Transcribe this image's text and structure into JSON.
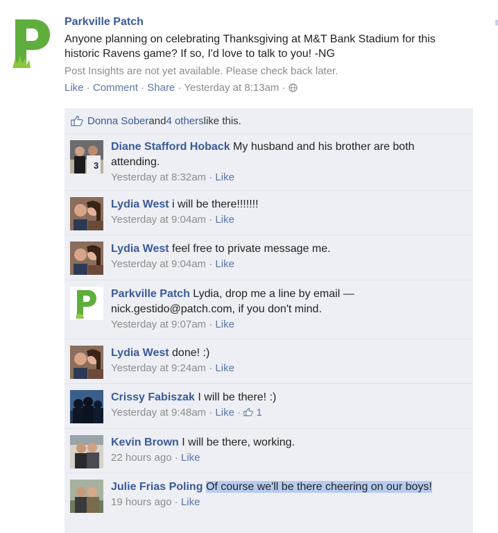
{
  "post": {
    "author": "Parkville Patch",
    "text": "Anyone planning on celebrating Thanksgiving at M&T Bank Stadium for this historic Ravens game? If so, I'd love to talk to you! -NG",
    "insights": "Post Insights are not yet available. Please check back later.",
    "actions": {
      "like": "Like",
      "comment": "Comment",
      "share": "Share",
      "sep": " · ",
      "timestamp": "Yesterday at 8:13am"
    }
  },
  "likes": {
    "name": "Donna Sober",
    "connector": " and ",
    "others": "4 others",
    "suffix": " like this."
  },
  "comments": [
    {
      "name": "Diane Stafford Hoback",
      "text": "My husband and his brother are both attending.",
      "time": "Yesterday at 8:32am",
      "like": "Like"
    },
    {
      "name": "Lydia West",
      "text": "i will be there!!!!!!!",
      "time": "Yesterday at 9:04am",
      "like": "Like"
    },
    {
      "name": "Lydia West",
      "text": "feel free to private message me.",
      "time": "Yesterday at 9:04am",
      "like": "Like"
    },
    {
      "name": "Parkville Patch",
      "text": "Lydia, drop me a line by email — nick.gestido@patch.com, if you don't mind.",
      "time": "Yesterday at 9:07am",
      "like": "Like"
    },
    {
      "name": "Lydia West",
      "text": "done! :)",
      "time": "Yesterday at 9:24am",
      "like": "Like"
    },
    {
      "name": "Crissy Fabiszak",
      "text": "I will be there! :)",
      "time": "Yesterday at 9:48am",
      "like": "Like",
      "like_count": "1"
    },
    {
      "name": "Kevin Brown",
      "text": "I will be there, working.",
      "time": "22 hours ago",
      "like": "Like"
    },
    {
      "name": "Julie Frias Poling",
      "text": "Of course we'll be there cheering on our boys!",
      "time": "19 hours ago",
      "like": "Like"
    }
  ],
  "meta_sep": " · ",
  "colors": {
    "link": "#3b5998",
    "muted": "#8c8c8c",
    "panel": "#edeff4",
    "logo_green": "#5fae3c",
    "highlight": "#b6cbf0"
  }
}
